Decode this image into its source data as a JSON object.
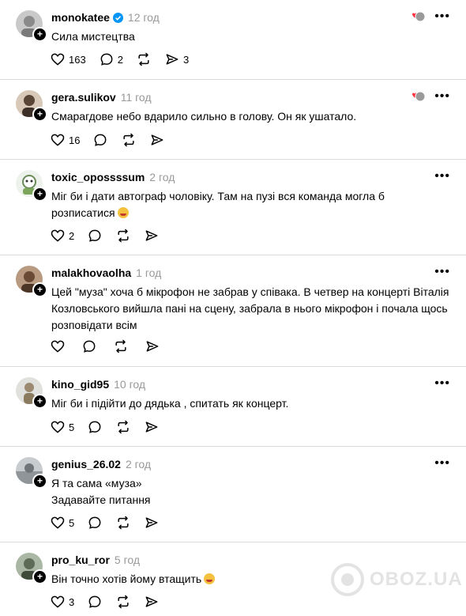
{
  "posts": [
    {
      "user": "monokatee",
      "time": "12 год",
      "verified": true,
      "text_lines": [
        "Сила мистецтва"
      ],
      "likes": "163",
      "comments": "2",
      "shares": "3",
      "has_likers": true,
      "emoji": false
    },
    {
      "user": "gera.sulikov",
      "time": "11 год",
      "verified": false,
      "text_lines": [
        "Смарагдове небо вдарило сильно в голову. Он як ушатало."
      ],
      "likes": "16",
      "comments": "",
      "shares": "",
      "has_likers": true,
      "emoji": false
    },
    {
      "user": "toxic_opossssum",
      "time": "2 год",
      "verified": false,
      "text_lines": [
        "Міг би і дати автограф чоловіку. Там на пузі вся команда могла б",
        "розписатися"
      ],
      "likes": "2",
      "comments": "",
      "shares": "",
      "has_likers": false,
      "emoji": true
    },
    {
      "user": "malakhovaolha",
      "time": "1 год",
      "verified": false,
      "text_lines": [
        "Цей \"муза\" хоча б мікрофон не забрав у співака. В четвер на концерті Віталія",
        "Козловського вийшла пані на сцену, забрала в нього мікрофон і почала щось",
        "розповідати всім"
      ],
      "likes": "",
      "comments": "",
      "shares": "",
      "has_likers": false,
      "emoji": false
    },
    {
      "user": "kino_gid95",
      "time": "10 год",
      "verified": false,
      "text_lines": [
        "Міг би і підійти до дядька , спитать як концерт."
      ],
      "likes": "5",
      "comments": "",
      "shares": "",
      "has_likers": false,
      "emoji": false
    },
    {
      "user": "genius_26.02",
      "time": "2 год",
      "verified": false,
      "text_lines": [
        "Я та сама «муза»",
        "Задавайте питання"
      ],
      "likes": "5",
      "comments": "",
      "shares": "",
      "has_likers": false,
      "emoji": false
    },
    {
      "user": "pro_ku_ror",
      "time": "5 год",
      "verified": false,
      "text_lines": [
        "Він точно хотів йому втащить"
      ],
      "likes": "3",
      "comments": "",
      "shares": "",
      "has_likers": false,
      "emoji": true
    }
  ],
  "watermark": "OBOZ.UA",
  "colors": {
    "text": "#000000",
    "muted": "#999999",
    "verified": "#0095f6",
    "divider": "#dbdbdb",
    "like_red": "#ff3040"
  }
}
